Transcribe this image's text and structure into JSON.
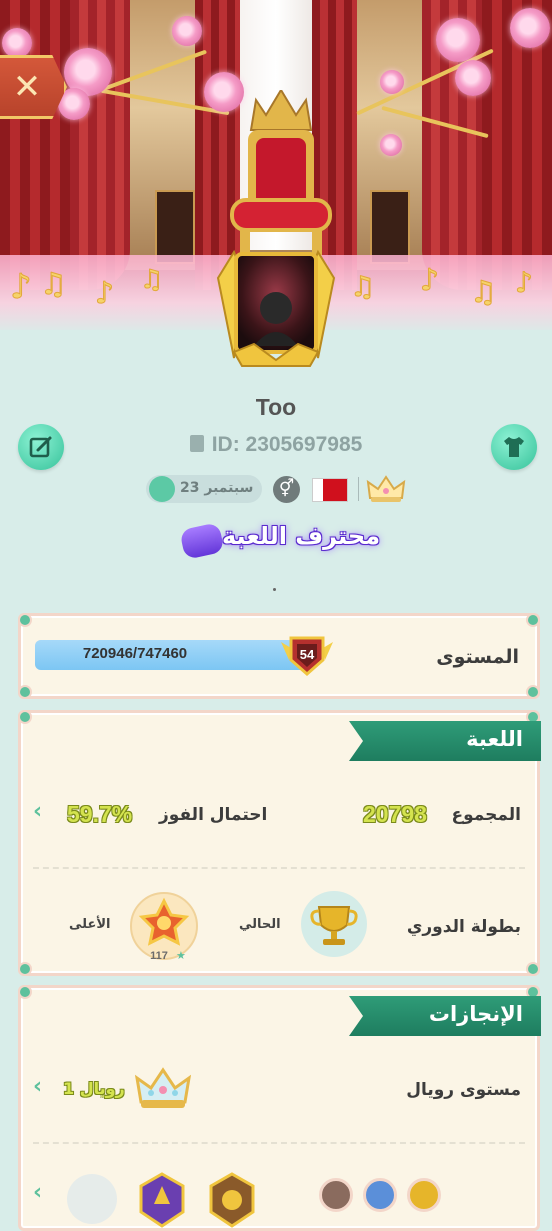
{
  "profile": {
    "name": "Too",
    "id_text": "ID: 2305697985",
    "birthday": "23 سبتمبر",
    "gender_symbol": "⚥",
    "title_badge": "محترف اللعبة"
  },
  "level": {
    "label": "المستوى",
    "xp_text": "720946/747460",
    "xp_current": 720946,
    "xp_max": 747460,
    "level_number": "54"
  },
  "game_section": {
    "title": "اللعبة",
    "total_label": "المجموع",
    "total_value": "20798",
    "win_rate_label": "احتمال الفوز",
    "win_rate_value": "59.7%",
    "league_label": "بطولة الدوري",
    "current_label": "الحالي",
    "highest_label": "الأعلى",
    "highest_badge_number": "117"
  },
  "achievements_section": {
    "title": "الإنجازات",
    "royal_level_label": "مستوى رويال",
    "royal_level_value": "رويال 1"
  },
  "colors": {
    "background": "#d8ede9",
    "accent_green": "#2f9c78",
    "xp_fill": "#7cc6f3",
    "value_yellow": "#d4e34f",
    "close_orange": "#c44e33"
  },
  "icons": {
    "close": "close-icon",
    "edit": "edit-icon",
    "shirt": "shirt-icon",
    "document": "document-icon",
    "cake": "cake-icon",
    "gender": "gender-icon",
    "flag": "bahrain-flag-icon",
    "crown": "crown-icon",
    "controller": "gamepad-icon",
    "trophy": "trophy-icon"
  }
}
